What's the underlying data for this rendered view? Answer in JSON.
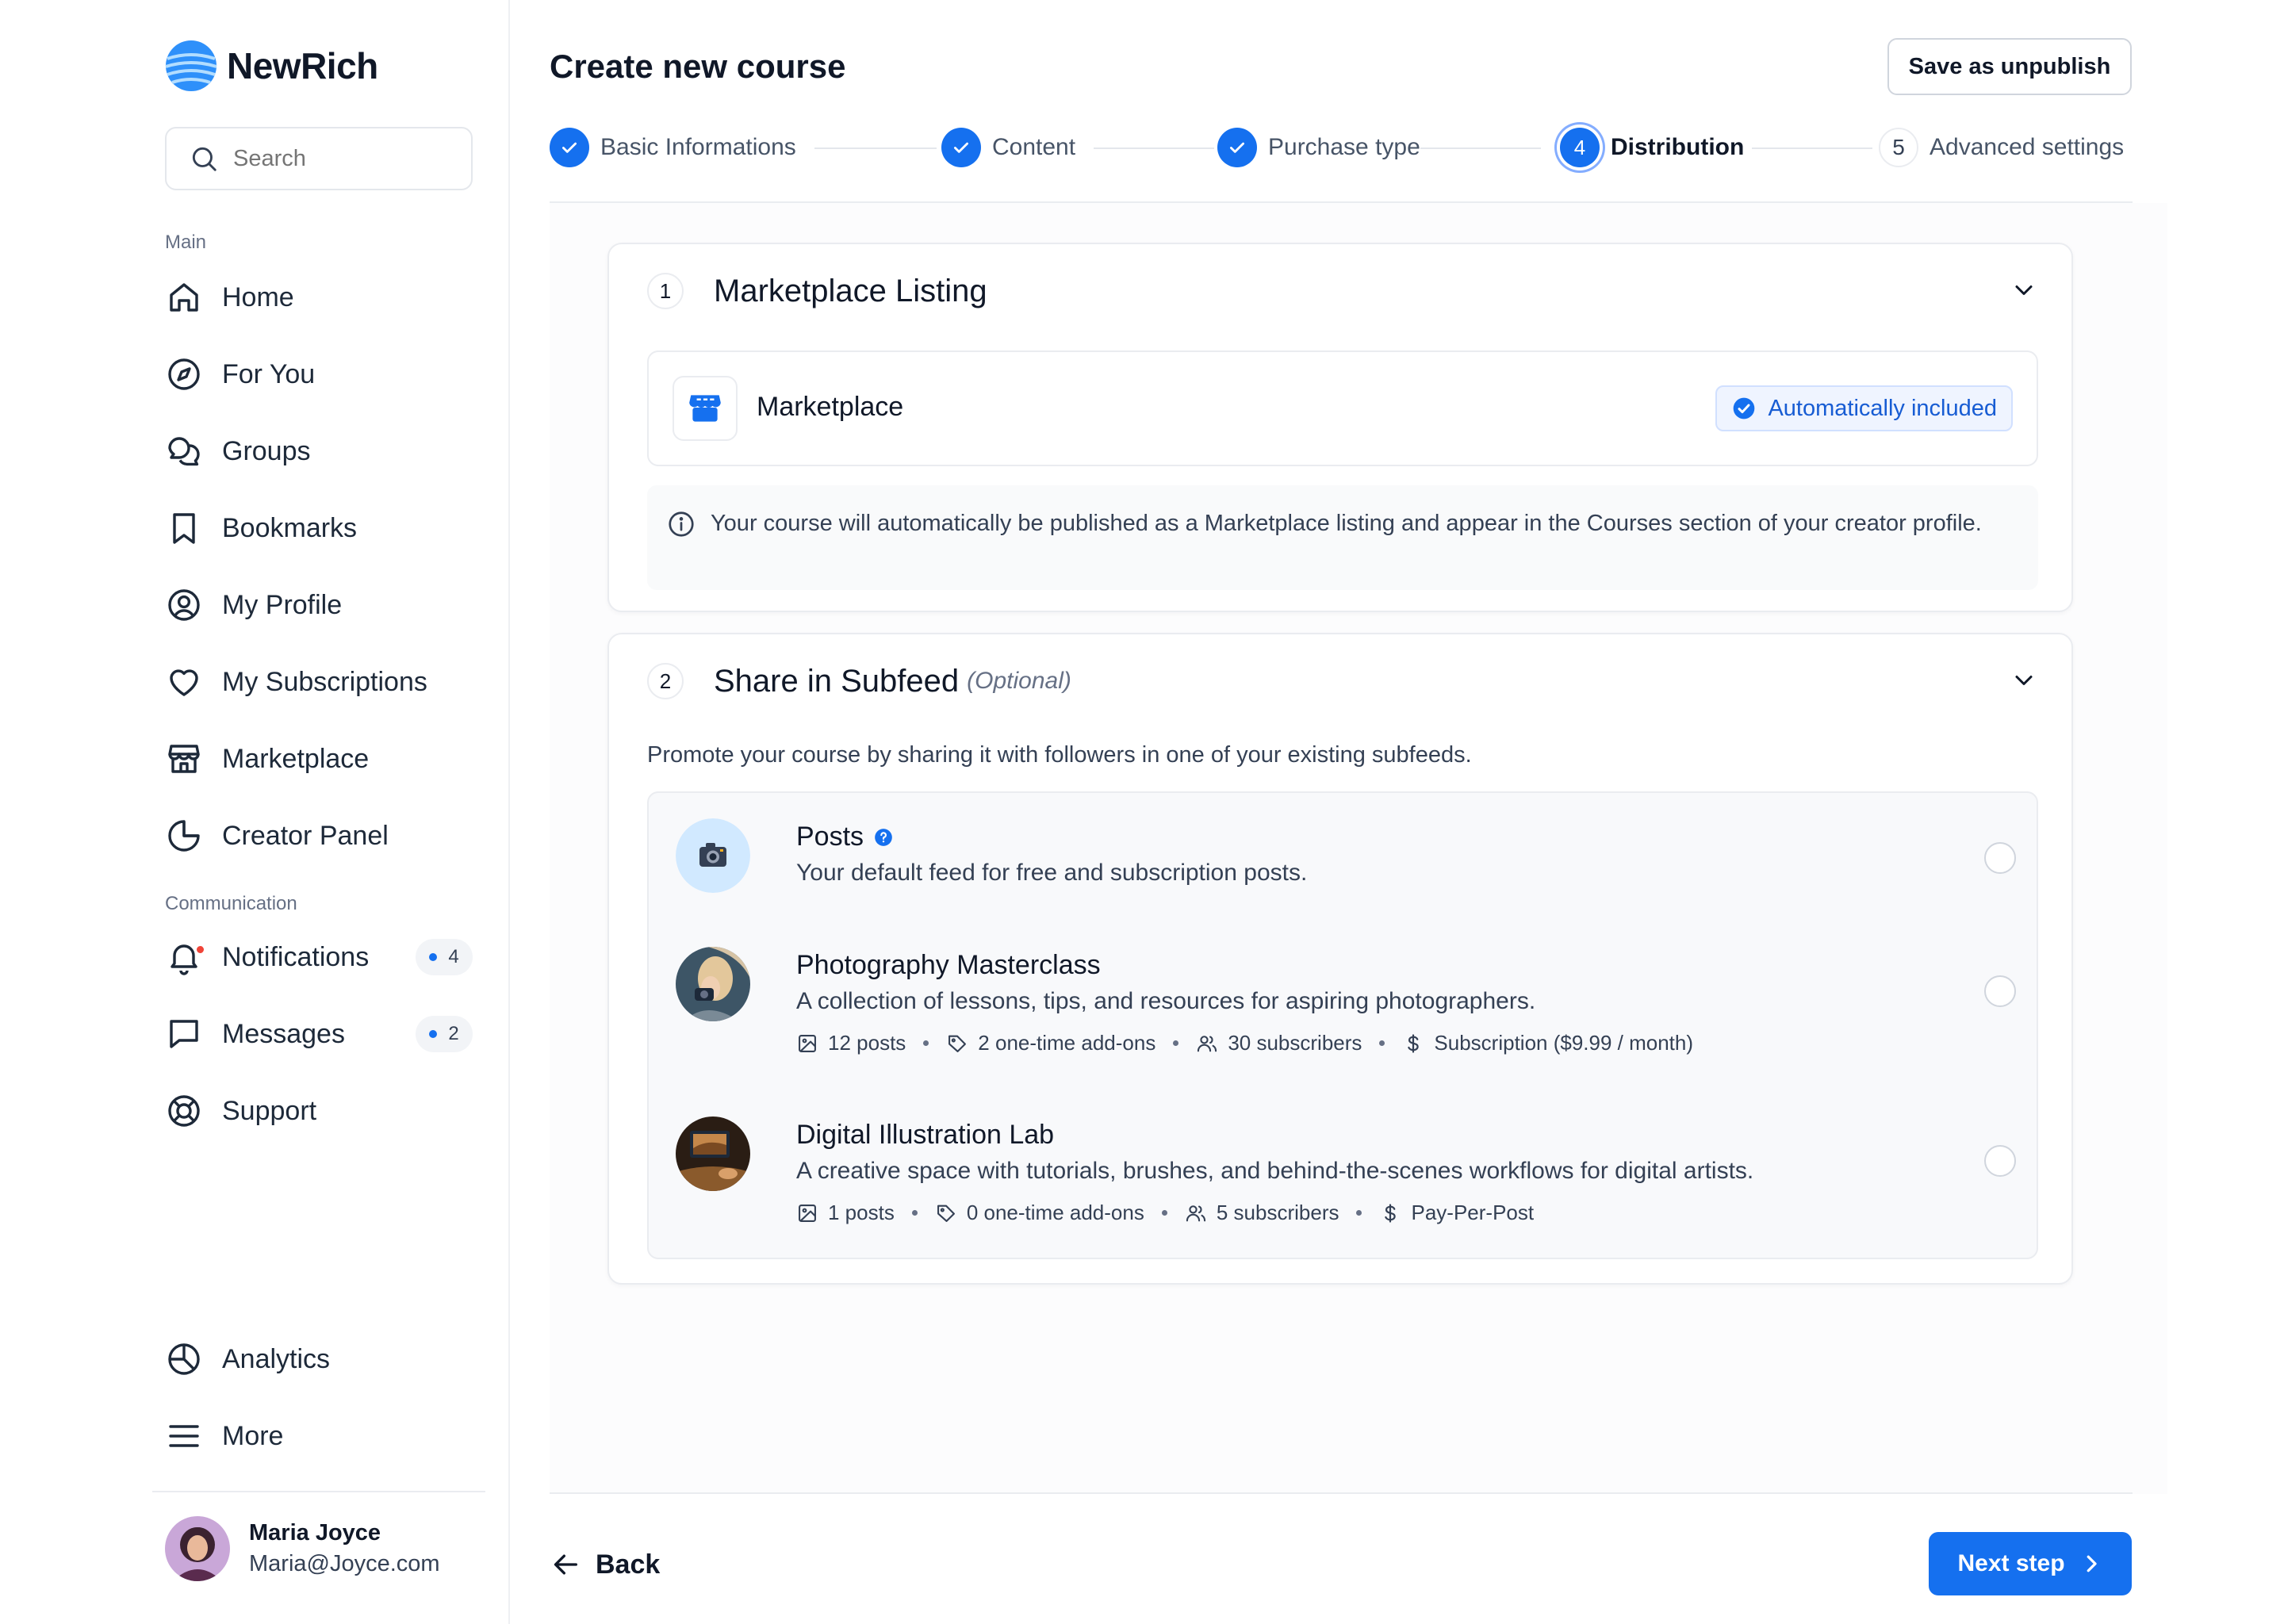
{
  "app": {
    "name": "NewRich"
  },
  "search": {
    "placeholder": "Search"
  },
  "sidebar": {
    "main_label": "Main",
    "main_items": [
      {
        "label": "Home",
        "icon": "home-icon"
      },
      {
        "label": "For You",
        "icon": "compass-icon"
      },
      {
        "label": "Groups",
        "icon": "chat-bubbles-icon"
      },
      {
        "label": "Bookmarks",
        "icon": "bookmark-icon"
      },
      {
        "label": "My Profile",
        "icon": "user-circle-icon"
      },
      {
        "label": "My Subscriptions",
        "icon": "heart-icon"
      },
      {
        "label": "Marketplace",
        "icon": "store-icon"
      },
      {
        "label": "Creator Panel",
        "icon": "pie-chart-icon"
      }
    ],
    "communication_label": "Communication",
    "communication_items": [
      {
        "label": "Notifications",
        "icon": "bell-icon",
        "badge": "4"
      },
      {
        "label": "Messages",
        "icon": "message-icon",
        "badge": "2"
      },
      {
        "label": "Support",
        "icon": "lifebuoy-icon"
      }
    ],
    "bottom_items": [
      {
        "label": "Analytics",
        "icon": "analytics-icon"
      },
      {
        "label": "More",
        "icon": "menu-icon"
      }
    ],
    "user": {
      "name": "Maria Joyce",
      "email": "Maria@Joyce.com"
    }
  },
  "header": {
    "title": "Create new course",
    "save_label": "Save as unpublish"
  },
  "stepper": {
    "steps": [
      {
        "label": "Basic Informations",
        "state": "done"
      },
      {
        "label": "Content",
        "state": "done"
      },
      {
        "label": "Purchase type",
        "state": "done"
      },
      {
        "number": "4",
        "label": "Distribution",
        "state": "active"
      },
      {
        "number": "5",
        "label": "Advanced settings",
        "state": "todo"
      }
    ]
  },
  "marketplace_section": {
    "number": "1",
    "title": "Marketplace Listing",
    "item_label": "Marketplace",
    "badge": "Automatically included",
    "info": "Your course will automatically be published as a Marketplace listing and appear in the Courses section of your creator profile."
  },
  "subfeed_section": {
    "number": "2",
    "title": "Share in Subfeed",
    "optional": "(Optional)",
    "description": "Promote your course by sharing it with followers in one of your existing subfeeds.",
    "feeds": [
      {
        "name": "Posts",
        "description": "Your default feed for free and subscription posts."
      },
      {
        "name": "Photography Masterclass",
        "description": "A collection of lessons, tips, and resources for aspiring photographers.",
        "posts": "12 posts",
        "addons": "2 one-time add-ons",
        "subscribers": "30 subscribers",
        "pricing": "Subscription ($9.99 / month)"
      },
      {
        "name": "Digital Illustration Lab",
        "description": "A creative space with tutorials, brushes, and behind-the-scenes workflows for digital artists.",
        "posts": "1 posts",
        "addons": "0 one-time add-ons",
        "subscribers": "5 subscribers",
        "pricing": "Pay-Per-Post"
      }
    ]
  },
  "footer": {
    "back_label": "Back",
    "next_label": "Next step"
  },
  "colors": {
    "accent": "#1570ef",
    "badge_bg": "#eff4ff",
    "notification_dot": "#f04438"
  }
}
